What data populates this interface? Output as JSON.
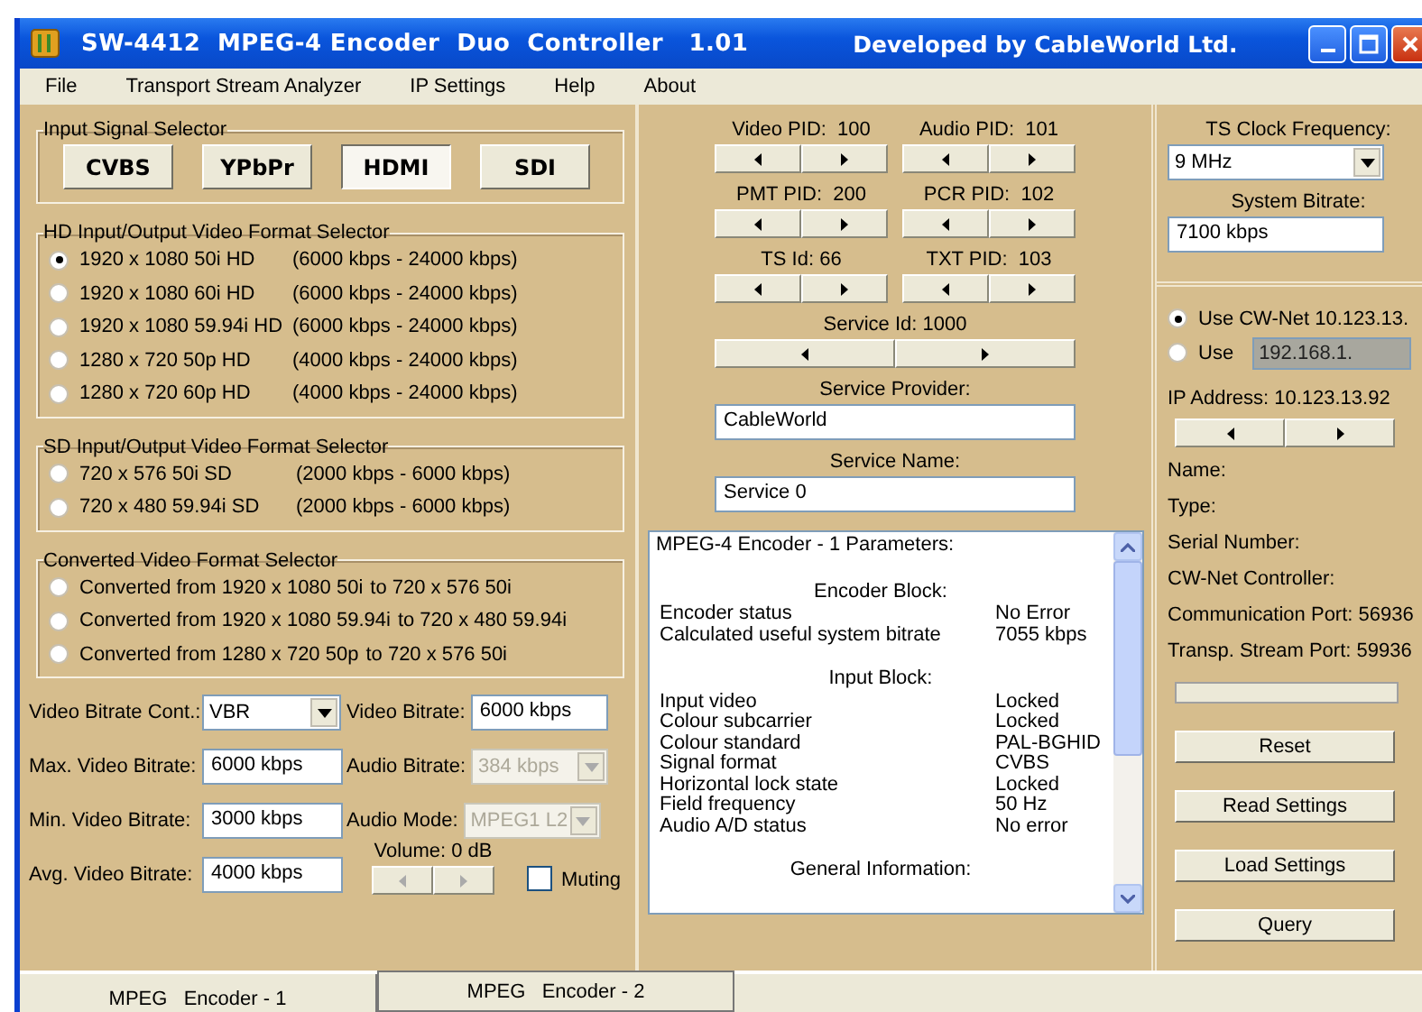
{
  "window": {
    "title": "SW-4412  MPEG-4 Encoder  Duo  Controller   1.01",
    "developer": "Developed by CableWorld Ltd."
  },
  "menu": [
    "File",
    "Transport Stream Analyzer",
    "IP Settings",
    "Help",
    "About"
  ],
  "input_signal": {
    "title": "Input Signal Selector",
    "buttons": [
      {
        "label": "CVBS",
        "selected": false
      },
      {
        "label": "YPbPr",
        "selected": false
      },
      {
        "label": "HDMI",
        "selected": true
      },
      {
        "label": "SDI",
        "selected": false
      }
    ]
  },
  "hd_formats": {
    "title": "HD Input/Output Video Format Selector",
    "options": [
      {
        "label": "1920 x 1080 50i HD",
        "range": "(6000 kbps - 24000 kbps)",
        "selected": true
      },
      {
        "label": "1920 x 1080 60i HD",
        "range": "(6000 kbps - 24000 kbps)",
        "selected": false
      },
      {
        "label": "1920 x 1080 59.94i HD",
        "range": "(6000 kbps - 24000 kbps)",
        "selected": false
      },
      {
        "label": "1280 x 720 50p HD",
        "range": "(4000 kbps - 24000 kbps)",
        "selected": false
      },
      {
        "label": "1280 x 720 60p HD",
        "range": "(4000 kbps - 24000 kbps)",
        "selected": false
      }
    ]
  },
  "sd_formats": {
    "title": "SD Input/Output  Video Format Selector",
    "options": [
      {
        "label": "720 x 576 50i SD",
        "range": "(2000 kbps - 6000 kbps)",
        "selected": false
      },
      {
        "label": "720 x 480 59.94i SD",
        "range": "(2000 kbps - 6000 kbps)",
        "selected": false
      }
    ]
  },
  "converted_formats": {
    "title": "Converted Video Format Selector",
    "options": [
      {
        "label": "Converted from 1920 x 1080 50i",
        "range": "to 720 x 576 50i",
        "selected": false
      },
      {
        "label": "Converted from 1920 x 1080 59.94i",
        "range": "to 720 x 480 59.94i",
        "selected": false
      },
      {
        "label": "Converted from 1280 x 720 50p",
        "range": "to 720 x 576 50i",
        "selected": false
      }
    ]
  },
  "bitrate_fields": [
    {
      "label": "Video Bitrate Cont.:",
      "value": "VBR",
      "kind": "dropdown",
      "disabled": false
    },
    {
      "label": "Video Bitrate:",
      "value": "6000 kbps",
      "kind": "text",
      "disabled": false
    },
    {
      "label": "Max. Video Bitrate:",
      "value": "6000 kbps",
      "kind": "text",
      "disabled": false
    },
    {
      "label": "Audio Bitrate:",
      "value": "384 kbps",
      "kind": "dropdown",
      "disabled": true
    },
    {
      "label": "Min. Video Bitrate:",
      "value": "3000 kbps",
      "kind": "text",
      "disabled": false
    },
    {
      "label": "Audio Mode:",
      "value": "MPEG1 L2",
      "kind": "dropdown",
      "disabled": true
    },
    {
      "label": "Avg. Video Bitrate:",
      "value": "4000 kbps",
      "kind": "text",
      "disabled": false
    }
  ],
  "volume": {
    "label": "Volume: 0 dB",
    "disabled": true
  },
  "muting": {
    "label": "Muting",
    "checked": false
  },
  "pids": [
    "Video PID:  100",
    "Audio PID:  101",
    "PMT PID:  200",
    "PCR PID:  102",
    "TS Id: 66",
    "TXT PID:  103"
  ],
  "service_id": "Service Id: 1000",
  "service_provider": {
    "label": "Service Provider:",
    "value": "CableWorld"
  },
  "service_name": {
    "label": "Service Name:",
    "value": "Service 0"
  },
  "parameters": {
    "title": "MPEG-4 Encoder - 1  Parameters:",
    "sections": [
      {
        "heading": "Encoder Block:",
        "rows": [
          {
            "name": "Encoder status",
            "value": "No Error"
          },
          {
            "name": "Calculated useful system bitrate",
            "value": "7055 kbps"
          }
        ]
      },
      {
        "heading": "Input Block:",
        "rows": [
          {
            "name": "Input video",
            "value": "Locked"
          },
          {
            "name": "Colour subcarrier",
            "value": "Locked"
          },
          {
            "name": "Colour standard",
            "value": "PAL-BGHID"
          },
          {
            "name": "Signal format",
            "value": "CVBS"
          },
          {
            "name": "Horizontal lock state",
            "value": "Locked"
          },
          {
            "name": "Field frequency",
            "value": "50 Hz"
          },
          {
            "name": "Audio A/D status",
            "value": "No error"
          }
        ]
      },
      {
        "heading": "General Information:"
      }
    ]
  },
  "ts_clock": {
    "label": "TS Clock Frequency:",
    "value": "9 MHz"
  },
  "system_bitrate": {
    "label": "System Bitrate:",
    "value": "7100 kbps"
  },
  "network": {
    "options": [
      {
        "label": "Use CW-Net 10.123.13.",
        "selected": true
      },
      {
        "label": "Use",
        "value": "192.168.1.",
        "selected": false
      }
    ],
    "ip_address": "IP Address: 10.123.13.92",
    "info": [
      "Name:",
      "Type:",
      "Serial Number:",
      "CW-Net Controller:",
      "Communication Port: 56936",
      "Transp. Stream Port: 59936"
    ],
    "progress": {
      "level": 0
    },
    "buttons": [
      "Reset",
      "Read Settings",
      "Load Settings",
      "Query"
    ]
  },
  "tabs": [
    {
      "label": "MPEG   Encoder - 1",
      "selected": true
    },
    {
      "label": "MPEG   Encoder - 2",
      "selected": false
    }
  ]
}
